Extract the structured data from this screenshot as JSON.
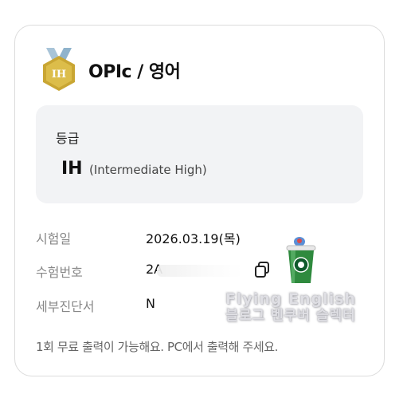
{
  "header": {
    "badge_text": "IH",
    "title": "OPIc / 영어"
  },
  "grade": {
    "label": "등급",
    "code": "IH",
    "full_name": "(Intermediate High)"
  },
  "details": [
    {
      "label": "시험일",
      "value": "2026.03.19(목)"
    },
    {
      "label": "수험번호",
      "value": "2A"
    },
    {
      "label": "세부진단서",
      "value": "N"
    }
  ],
  "watermark": {
    "line1": "Flying English",
    "line2": "블로그 벤쿠버 슬렉터"
  },
  "footnote": "1회 무료 출력이 가능해요. PC에서 출력해 주세요.",
  "colors": {
    "medal_gold": "#d3b23a",
    "medal_ribbon": "#a8c4d8",
    "grade_box_bg": "#f2f3f5",
    "card_border": "#dcdcdc",
    "label_gray": "#888888"
  },
  "icons": {
    "medal": "medal-icon",
    "copy": "copy-icon",
    "sticker": "starbucks-cup-sticker"
  }
}
